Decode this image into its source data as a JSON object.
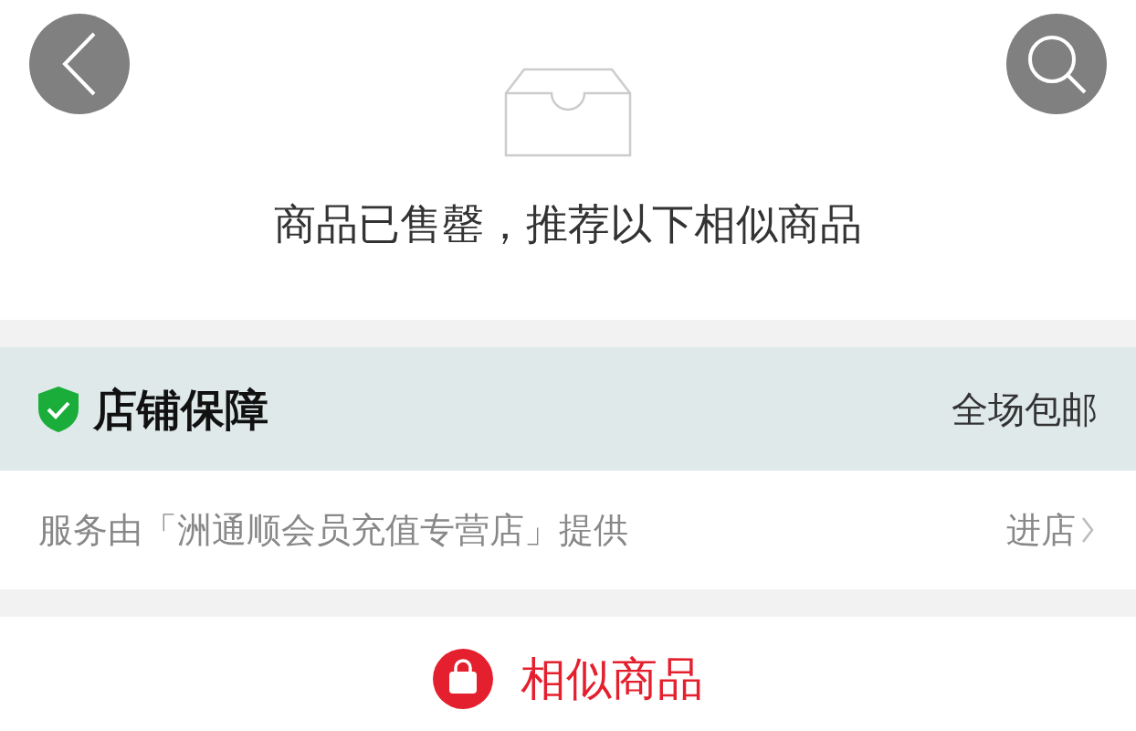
{
  "notice": {
    "message": "商品已售罄，推荐以下相似商品"
  },
  "guarantee": {
    "title": "店铺保障",
    "badge": "全场包邮"
  },
  "store": {
    "text": "服务由「洲通顺会员充值专营店」提供",
    "link": "进店"
  },
  "similar": {
    "title": "相似商品"
  }
}
